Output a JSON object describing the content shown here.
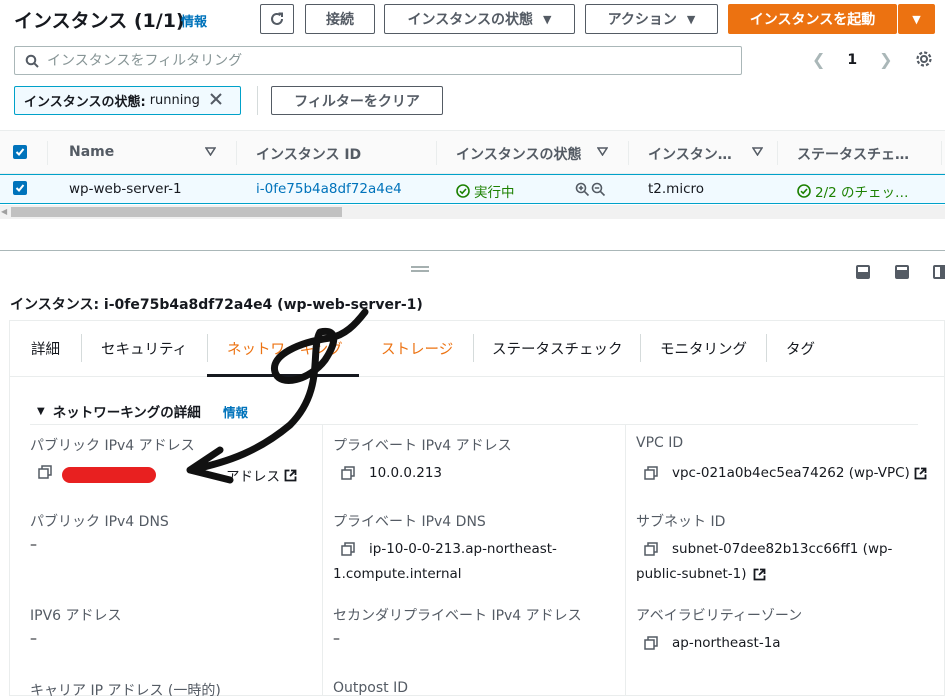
{
  "header": {
    "title": "インスタンス (1/1)",
    "info": "情報",
    "connect": "接続",
    "instance_state": "インスタンスの状態",
    "actions": "アクション",
    "launch": "インスタンスを起動"
  },
  "search": {
    "placeholder": "インスタンスをフィルタリング",
    "value": ""
  },
  "pagination": {
    "page": "1"
  },
  "filter": {
    "key": "インスタンスの状態:",
    "value": "running",
    "clear": "フィルターをクリア"
  },
  "table": {
    "columns": [
      "Name",
      "インスタンス ID",
      "インスタンスの状態",
      "インスタン…",
      "ステータスチェ…"
    ],
    "row": {
      "name": "wp-web-server-1",
      "instance_id": "i-0fe75b4a8df72a4e4",
      "state": "実行中",
      "type": "t2.micro",
      "status_check": "2/2 のチェッ…"
    }
  },
  "detail": {
    "title": "インスタンス: i-0fe75b4a8df72a4e4 (wp-web-server-1)",
    "tabs": [
      "詳細",
      "セキュリティ",
      "ネットワーキング",
      "ストレージ",
      "ステータスチェック",
      "モニタリング",
      "タグ"
    ],
    "active_tab": "ネットワーキング",
    "section_title": "ネットワーキングの詳細",
    "section_info": "情報",
    "fields": {
      "public_ipv4_label": "パブリック IPv4 アドレス",
      "public_ipv4_link": "アドレス",
      "private_ipv4_label": "プライベート IPv4 アドレス",
      "private_ipv4_value": "10.0.0.213",
      "vpc_label": "VPC ID",
      "vpc_value": "vpc-021a0b4ec5ea74262 (wp-VPC)",
      "public_dns_label": "パブリック IPv4 DNS",
      "public_dns_value": "–",
      "private_dns_label": "プライベート IPv4 DNS",
      "private_dns_line1": "ip-10-0-0-213.ap-northeast-",
      "private_dns_line2": "1.compute.internal",
      "subnet_label": "サブネット ID",
      "subnet_line1": "subnet-07dee82b13cc66ff1 (wp-",
      "subnet_line2": "public-subnet-1)",
      "ipv6_label": "IPV6 アドレス",
      "ipv6_value": "–",
      "secondary_label": "セカンダリプライベート IPv4 アドレス",
      "secondary_value": "–",
      "az_label": "アベイラビリティーゾーン",
      "az_value": "ap-northeast-1a",
      "carrier_label": "キャリア IP アドレス (一時的)",
      "outpost_label": "Outpost ID"
    }
  },
  "colors": {
    "accent": "#ec7211",
    "link": "#0073bb",
    "success": "#1d8102"
  }
}
